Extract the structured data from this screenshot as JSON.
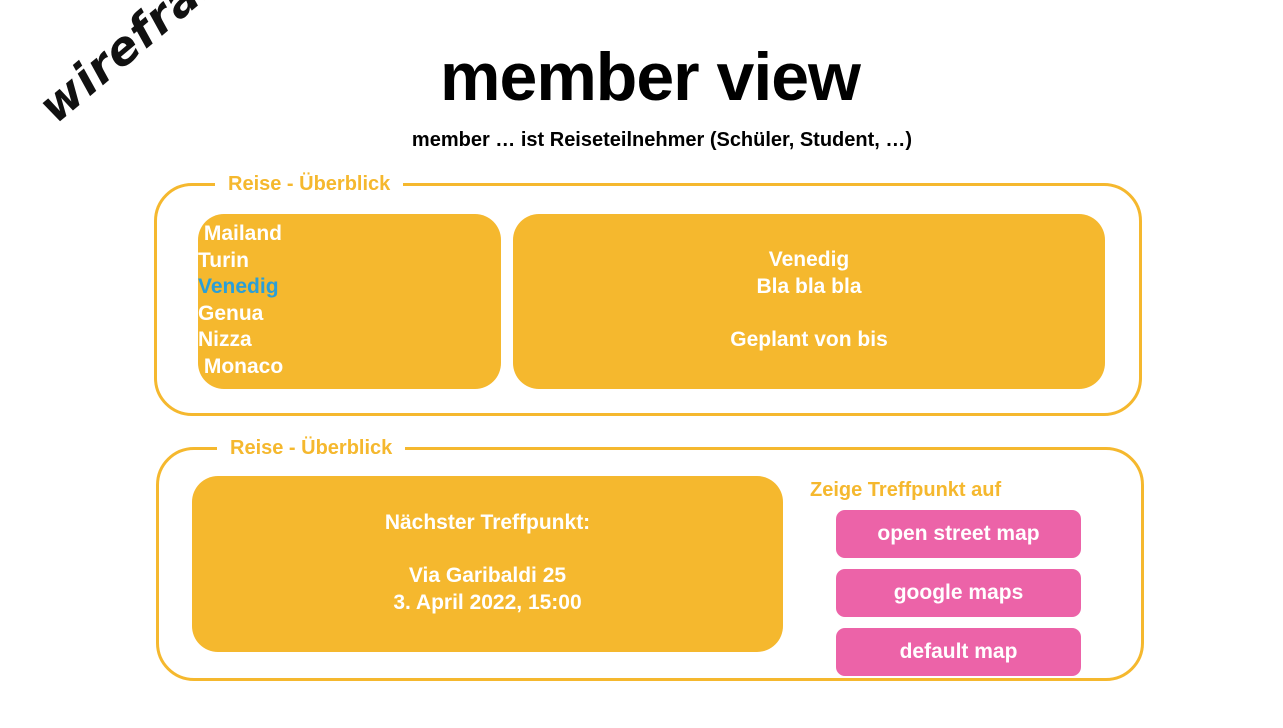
{
  "tag": "wireframe",
  "header": {
    "title": "member view",
    "subtitle": "member … ist Reiseteilnehmer (Schüler, Student, …)"
  },
  "overview": {
    "legend": "Reise - Überblick",
    "cities": [
      " Mailand",
      "Turin",
      "Venedig",
      "Genua",
      "Nizza",
      " Monaco"
    ],
    "active_city": "Venedig",
    "detail": {
      "name": "Venedig",
      "description": "Bla bla bla",
      "planned": "Geplant von bis"
    }
  },
  "meeting": {
    "legend": "Reise - Überblick",
    "heading": "Nächster Treffpunkt:",
    "address": "Via Garibaldi 25",
    "datetime": "3. April 2022, 15:00",
    "map_heading": "Zeige Treffpunkt auf",
    "buttons": [
      "open street map",
      "google maps",
      "default map"
    ]
  },
  "colors": {
    "accent": "#f5b82e",
    "button": "#ec63a8",
    "active_link": "#2a9fd8"
  }
}
